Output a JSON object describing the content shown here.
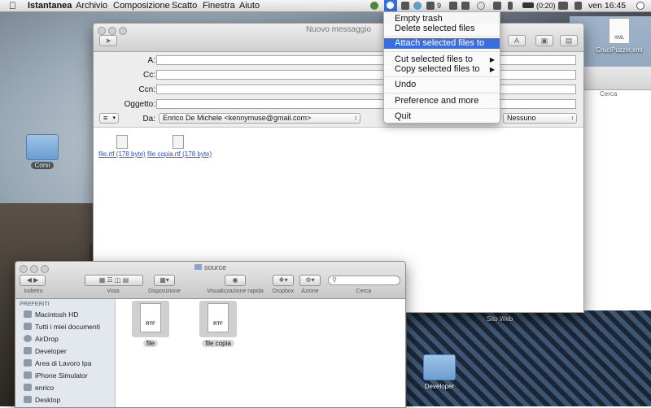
{
  "menubar": {
    "app_name": "Istantanea",
    "menus": [
      "Archivio",
      "Composizione",
      "Scatto",
      "Finestra",
      "Aiuto"
    ],
    "tray_text_9": "9",
    "battery": "(0:20)",
    "clock": "ven 16:45"
  },
  "dropdown": {
    "items": [
      "Empty trash",
      "Delete selected files",
      "Attach selected files to Mail",
      "Cut selected files to",
      "Copy selected files to",
      "Undo",
      "Preference and more",
      "Quit"
    ]
  },
  "mail": {
    "title": "Nuovo messaggio",
    "fields": {
      "to_label": "A:",
      "cc_label": "Cc:",
      "bcc_label": "Ccn:",
      "subject_label": "Oggetto:",
      "from_label": "Da:"
    },
    "from_value": "Enrico De Michele <kennymuse@gmail.com>",
    "signature_value": "Nessuno",
    "attachments": [
      "file.rtf (178 byte)",
      "file copia.rtf (178 byte)"
    ]
  },
  "side_panel": {
    "search_label": "Cerca"
  },
  "desktop": {
    "icons": [
      "CruciPuzzle.xml",
      "Corsi",
      "Sito Web",
      "Developer"
    ],
    "xml_badge": "XML"
  },
  "finder": {
    "title": "source",
    "toolbar_labels": {
      "back": "Indietro",
      "view": "Vista",
      "arrange": "Disposizione",
      "quicklook": "Visualizzazione rapida",
      "dropbox": "Dropbox",
      "action": "Azione",
      "search": "Cerca"
    },
    "sidebar_header": "PREFERITI",
    "sidebar_items": [
      "Macintosh HD",
      "Tutti i miei documenti",
      "AirDrop",
      "Developer",
      "Area di Lavoro Ipa",
      "iPhone Simulator",
      "enrico",
      "Desktop"
    ],
    "files": [
      "file",
      "file copia"
    ],
    "file_badge": "RTF"
  }
}
